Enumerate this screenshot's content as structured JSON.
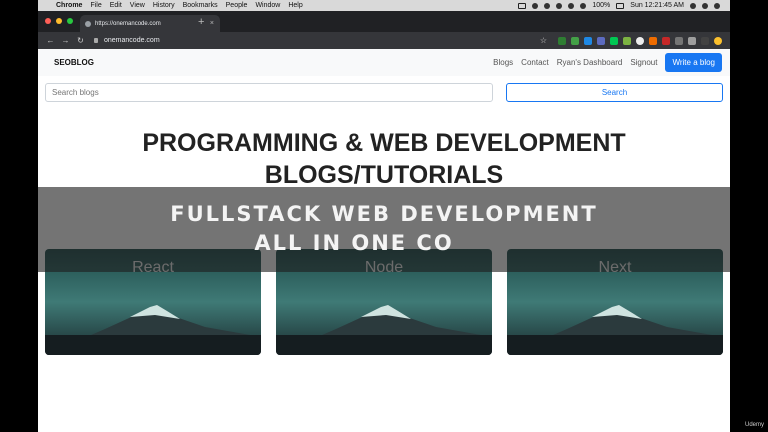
{
  "menubar": {
    "items": [
      "Chrome",
      "File",
      "Edit",
      "View",
      "History",
      "Bookmarks",
      "People",
      "Window",
      "Help"
    ],
    "battery": "100%",
    "clock": "Sun 12:21:45 AM"
  },
  "browser": {
    "tab_title": "https://onemancode.com",
    "url": "onemancode.com"
  },
  "site": {
    "brand": "SEOBLOG",
    "nav": [
      "Blogs",
      "Contact",
      "Ryan's Dashboard",
      "Signout"
    ],
    "cta": "Write a blog",
    "search_placeholder": "Search blogs",
    "search_button": "Search",
    "headline_line1": "PROGRAMMING & WEB DEVELOPMENT",
    "headline_line2": "BLOGS/TUTORIALS",
    "cards": [
      "React",
      "Node",
      "Next"
    ]
  },
  "overlay": {
    "line1": "FULLSTACK WEB DEVELOPMENT",
    "line2": "ALL IN ONE CO"
  },
  "watermark": "Udemy",
  "colors": {
    "accent": "#1877f2",
    "chrome_dark": "#202124"
  }
}
